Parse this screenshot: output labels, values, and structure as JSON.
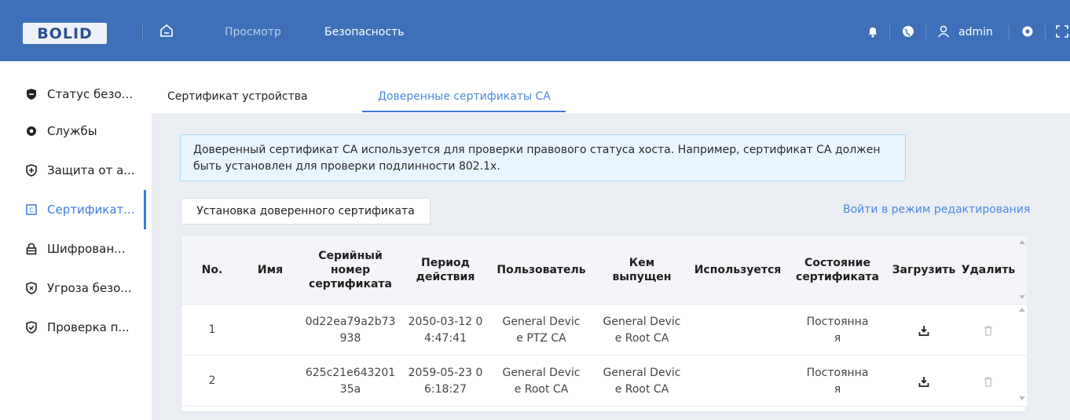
{
  "header": {
    "logo": "BOLID",
    "nav": [
      "Просмотр",
      "Безопасность"
    ],
    "user": "admin"
  },
  "sidebar": {
    "items": [
      {
        "label": "Статус безо...",
        "icon": "shield-status-icon"
      },
      {
        "label": "Службы",
        "icon": "gear-icon"
      },
      {
        "label": "Защита от а...",
        "icon": "shield-plus-icon"
      },
      {
        "label": "Сертификат...",
        "icon": "certificate-icon"
      },
      {
        "label": "Шифрован...",
        "icon": "lock-icon"
      },
      {
        "label": "Угроза безо...",
        "icon": "shield-warning-icon"
      },
      {
        "label": "Проверка п...",
        "icon": "shield-check-icon"
      }
    ]
  },
  "tabs": [
    "Сертификат устройства",
    "Доверенные сертификаты CA"
  ],
  "info": {
    "line1": "Доверенный сертификат CA используется для проверки правового статуса хоста. Например, сертификат CA должен",
    "line2": "быть установлен для проверки подлинности 802.1x."
  },
  "actions": {
    "install": "Установка доверенного сертификата",
    "edit": "Войти в режим редактирования"
  },
  "table": {
    "headers": {
      "no": "No.",
      "name": "Имя",
      "serial": [
        "Серийный",
        "номер",
        "сертификата"
      ],
      "period": [
        "Период",
        "действия"
      ],
      "user": "Пользователь",
      "issuer": [
        "Кем",
        "выпущен"
      ],
      "used": "Используется",
      "state": [
        "Состояние",
        "сертификата"
      ],
      "download": "Загрузить",
      "delete": "Удалить"
    },
    "rows": [
      {
        "no": "1",
        "name": "",
        "serial": [
          "0d22ea79a2b73",
          "938"
        ],
        "period": [
          "2050-03-12 0",
          "4:47:41"
        ],
        "user": [
          "General Devic",
          "e PTZ CA"
        ],
        "issuer": [
          "General Devic",
          "e Root CA"
        ],
        "used": "",
        "state": [
          "Постоянна",
          "я"
        ]
      },
      {
        "no": "2",
        "name": "",
        "serial": [
          "625c21e643201",
          "35a"
        ],
        "period": [
          "2059-05-23 0",
          "6:18:27"
        ],
        "user": [
          "General Devic",
          "e Root CA"
        ],
        "issuer": [
          "General Devic",
          "e Root CA"
        ],
        "used": "",
        "state": [
          "Постоянна",
          "я"
        ]
      }
    ]
  },
  "colors": {
    "header_bg": "#3e6fb8",
    "accent": "#3b7ae0",
    "info_bg": "#e9f5ff"
  }
}
